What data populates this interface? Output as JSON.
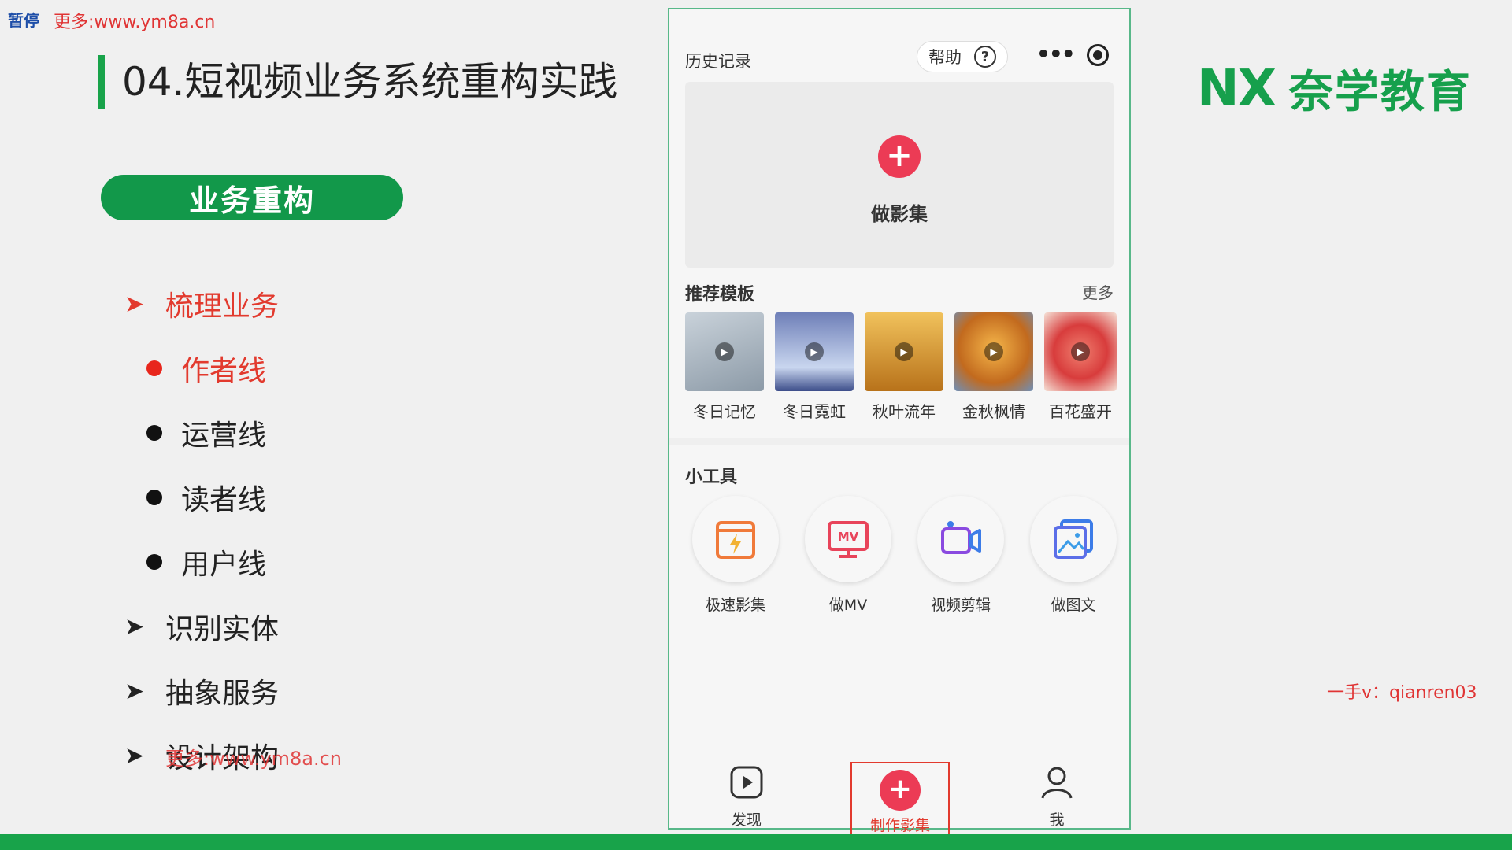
{
  "watermarks": {
    "pause": "暂停",
    "site": "更多:www.ym8a.cn",
    "site_bottom": "更多:www.ym8a.cn",
    "contact": "一手v：qianren03"
  },
  "slide": {
    "title": "04.短视频业务系统重构实践",
    "pill": "业务重构",
    "outline": [
      {
        "type": "arrow",
        "label": "梳理业务",
        "active": true
      },
      {
        "type": "dot",
        "label": "作者线",
        "active": true
      },
      {
        "type": "dot",
        "label": "运营线",
        "active": false
      },
      {
        "type": "dot",
        "label": "读者线",
        "active": false
      },
      {
        "type": "dot",
        "label": "用户线",
        "active": false
      },
      {
        "type": "arrow",
        "label": "识别实体",
        "active": false
      },
      {
        "type": "arrow",
        "label": "抽象服务",
        "active": false
      },
      {
        "type": "arrow",
        "label": "设计架构",
        "active": false
      }
    ]
  },
  "brand": {
    "logo": "NX",
    "name": "奈学教育",
    "color": "#16a04c"
  },
  "phone": {
    "history": "历史记录",
    "help": "帮助",
    "help_q": "?",
    "more_dots": "•••",
    "create_plus": "+",
    "create_label": "做影集",
    "templates_title": "推荐模板",
    "templates_more": "更多",
    "templates": [
      {
        "label": "冬日记忆",
        "color": "#9aa8b4"
      },
      {
        "label": "冬日霓虹",
        "color": "#7b93c9"
      },
      {
        "label": "秋叶流年",
        "color": "#d79a2b"
      },
      {
        "label": "金秋枫情",
        "color": "#e39a2e"
      },
      {
        "label": "百花盛开",
        "color": "#e3504a"
      }
    ],
    "tools_title": "小工具",
    "tools": [
      {
        "label": "极速影集",
        "icon": "lightning-photo-icon"
      },
      {
        "label": "做MV",
        "icon": "mv-monitor-icon"
      },
      {
        "label": "视频剪辑",
        "icon": "camera-icon"
      },
      {
        "label": "做图文",
        "icon": "image-text-icon"
      }
    ],
    "tabs": {
      "discover": "发现",
      "make_plus": "+",
      "make": "制作影集",
      "me": "我"
    }
  }
}
